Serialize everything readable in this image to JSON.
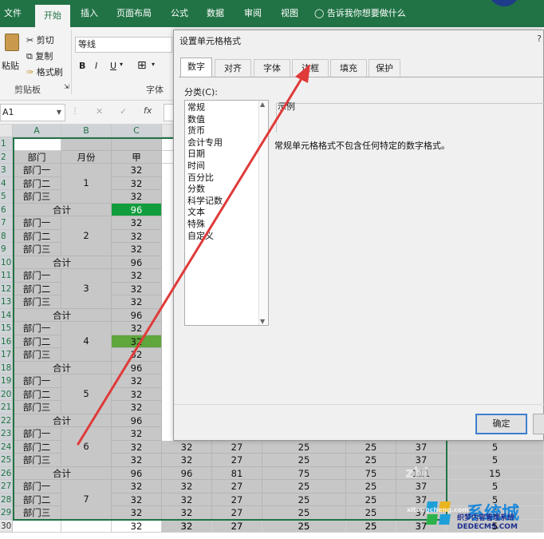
{
  "ribbon_tabs": [
    "文件",
    "开始",
    "插入",
    "页面布局",
    "公式",
    "数据",
    "审阅",
    "视图"
  ],
  "tell_me": "告诉我你想要做什么",
  "clipboard": {
    "paste": "粘贴",
    "cut": "剪切",
    "copy": "复制",
    "format_painter": "格式刷",
    "group": "剪贴板"
  },
  "font": {
    "name": "等线",
    "bold": "B",
    "italic": "I",
    "underline": "U",
    "group": "字体"
  },
  "name_box": "A1",
  "formula_icons": {
    "cancel": "✕",
    "enter": "✓",
    "fx": "fx"
  },
  "columns": [
    "A",
    "B",
    "C"
  ],
  "rows": [
    "1",
    "2",
    "3",
    "4",
    "5",
    "6",
    "7",
    "8",
    "9",
    "10",
    "11",
    "12",
    "13",
    "14",
    "15",
    "16",
    "17",
    "18",
    "19",
    "20",
    "21",
    "22",
    "23",
    "24",
    "25",
    "26",
    "27",
    "28",
    "29",
    "30"
  ],
  "table": {
    "header": {
      "dept": "部门",
      "month": "月份",
      "c": "甲"
    },
    "months": [
      "1",
      "2",
      "3",
      "4",
      "5",
      "6",
      "7"
    ],
    "dept_names": [
      "部门一",
      "部门二",
      "部门三"
    ],
    "subtotal": "合计",
    "value": "32",
    "subtotal_value": "96"
  },
  "visible_rows": [
    [
      "32",
      "27",
      "25",
      "25",
      "37",
      "5"
    ],
    [
      "32",
      "27",
      "25",
      "25",
      "37",
      "5"
    ],
    [
      "96",
      "81",
      "75",
      "75",
      "111",
      "15"
    ],
    [
      "32",
      "27",
      "25",
      "25",
      "37",
      "5"
    ],
    [
      "32",
      "27",
      "25",
      "25",
      "37",
      "5"
    ],
    [
      "32",
      "27",
      "25",
      "25",
      "37",
      "5"
    ],
    [
      "32",
      "27",
      "25",
      "25",
      "37",
      "5"
    ]
  ],
  "dialog": {
    "title": "设置单元格格式",
    "help": "?",
    "tabs": [
      "数字",
      "对齐",
      "字体",
      "边框",
      "填充",
      "保护"
    ],
    "category_label": "分类(C):",
    "categories": [
      "常规",
      "数值",
      "货币",
      "会计专用",
      "日期",
      "时间",
      "百分比",
      "分数",
      "科学记数",
      "文本",
      "特殊",
      "自定义"
    ],
    "sample_label": "示例",
    "description": "常规单元格格式不包含任何特定的数字格式。",
    "ok": "确定"
  },
  "watermarks": {
    "zhi": "zhi",
    "logo": "系统城",
    "site": "织梦内容管理系统",
    "url1": "xitongcheng.com",
    "url2": "DEDECMS.COM"
  },
  "colors": {
    "excel_green": "#217346",
    "arrow_red": "#e03a3a"
  }
}
